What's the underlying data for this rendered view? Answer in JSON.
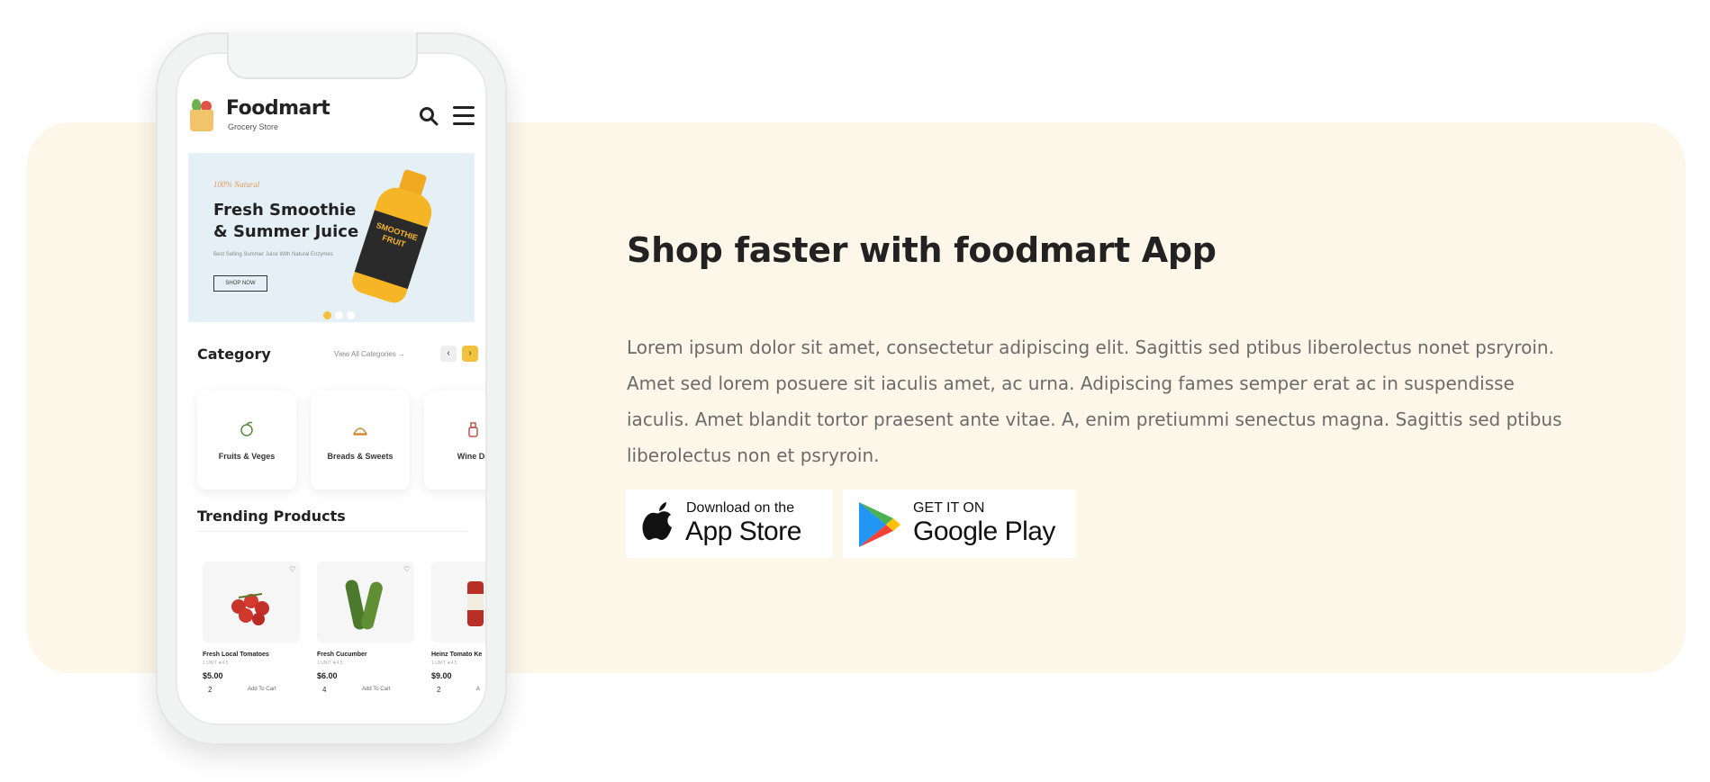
{
  "app": {
    "brand": "Foodmart",
    "brand_sub": "Grocery Store",
    "hero": {
      "tag": "100% Natural",
      "title": "Fresh Smoothie & Summer Juice",
      "description": "Best Selling Summer Juice With Natural Enzymes",
      "button": "SHOP NOW",
      "bottle_label": "SMOOTHIE FRUIT"
    },
    "category": {
      "title": "Category",
      "view_all": "View All Categories →",
      "prev": "‹",
      "next": "›",
      "items": [
        {
          "label": "Fruits & Veges",
          "icon": "fruit-icon"
        },
        {
          "label": "Breads & Sweets",
          "icon": "bread-icon"
        },
        {
          "label": "Wine Dri",
          "icon": "wine-icon"
        }
      ]
    },
    "trending": {
      "title": "Trending Products",
      "products": [
        {
          "name": "Fresh Local Tomatoes",
          "rating": "1 UNIT  ★4.5",
          "price": "$5.00",
          "qty": "2",
          "cart": "Add To Cart"
        },
        {
          "name": "Fresh Cucumber",
          "rating": "1 UNIT  ★4.5",
          "price": "$6.00",
          "qty": "4",
          "cart": "Add To Cart"
        },
        {
          "name": "Heinz Tomato Ke",
          "rating": "1 UNIT  ★4.5",
          "price": "$9.00",
          "qty": "2",
          "cart": "A"
        }
      ]
    }
  },
  "promo": {
    "headline": "Shop faster with foodmart App",
    "body": "Lorem ipsum dolor sit amet, consectetur adipiscing elit. Sagittis sed ptibus liberolectus nonet psryroin. Amet sed lorem posuere sit iaculis amet, ac urna. Adipiscing fames semper erat ac in suspendisse iaculis. Amet blandit tortor praesent ante vitae. A, enim pretiummi senectus magna. Sagittis sed ptibus liberolectus non et psryroin.",
    "app_store": {
      "small": "Download on the",
      "big": "App Store"
    },
    "google_play": {
      "small": "GET IT ON",
      "big": "Google Play"
    }
  },
  "colors": {
    "banner_bg": "#fdf7e9",
    "accent": "#f3c23d",
    "hero_bg": "#e5f0f6"
  }
}
